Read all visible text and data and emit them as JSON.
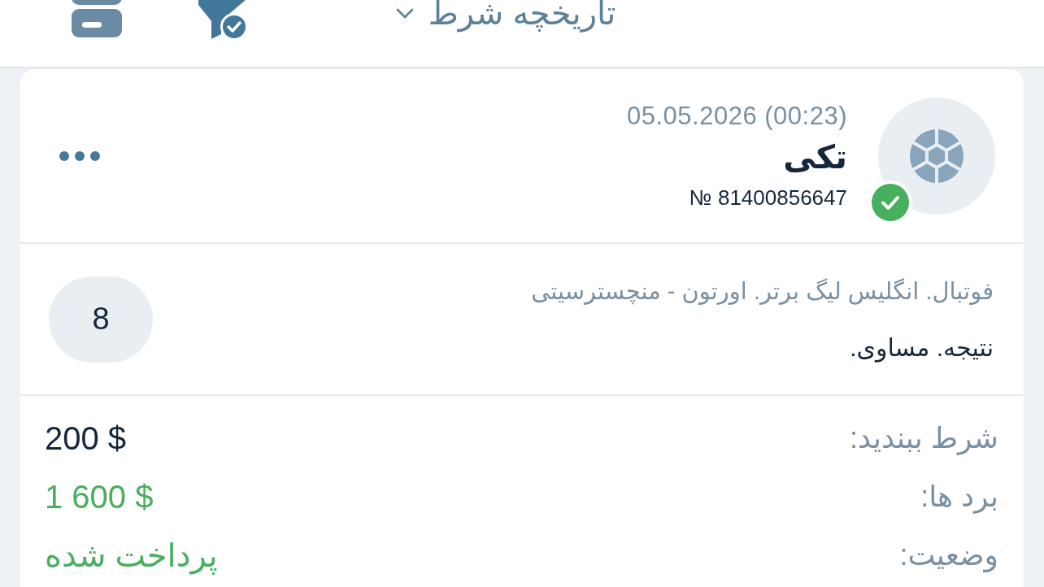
{
  "header": {
    "title": "تاریخچه شرط"
  },
  "bet": {
    "date": "05.05.2026 (00:23)",
    "type": "تکی",
    "number": "№ 81400856647",
    "won": true,
    "event": "فوتبال. انگلیس لیگ برتر. اورتون - منچسترسیتی",
    "outcome": "نتیجه. مساوی.",
    "odds": "8",
    "details": [
      {
        "label": "شرط ببندید:",
        "value": "200 $",
        "kind": "stake"
      },
      {
        "label": "برد ها:",
        "value": "1 600 $",
        "kind": "win"
      },
      {
        "label": "وضعیت:",
        "value": "پرداخت شده",
        "kind": "status"
      }
    ]
  }
}
